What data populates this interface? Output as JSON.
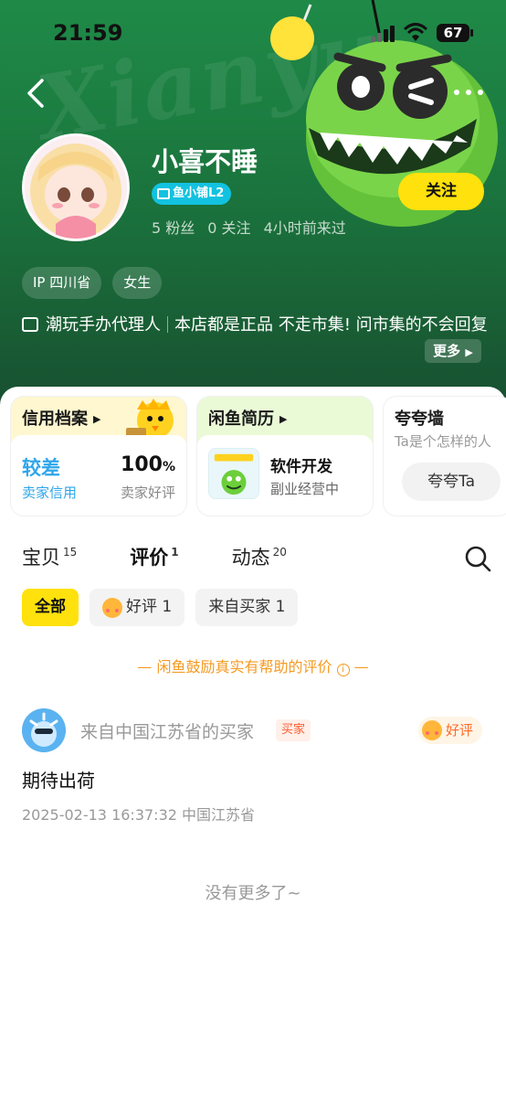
{
  "status_bar": {
    "time": "21:59",
    "battery": "67"
  },
  "header": {
    "watermark": "Xianyu",
    "username": "小喜不睡",
    "level_badge": "鱼小铺L2",
    "stats": {
      "fans": "5 粉丝",
      "following": "0 关注",
      "last_seen": "4小时前来过"
    },
    "follow_label": "关注",
    "tags": [
      "IP 四川省",
      "女生"
    ],
    "bio_part1": "潮玩手办代理人",
    "bio_part2": "本店都是正品  不走市集!  问市集的不会回复",
    "more_label": "更多"
  },
  "cards": {
    "credit": {
      "title": "信用档案",
      "level": "较差",
      "level_sub": "卖家信用",
      "rate": "100",
      "rate_unit": "%",
      "rate_sub": "卖家好评"
    },
    "resume": {
      "title": "闲鱼简历",
      "job": "软件开发",
      "job_sub": "副业经营中"
    },
    "praise": {
      "title": "夸夸墙",
      "subtitle": "Ta是个怎样的人",
      "button": "夸夸Ta"
    }
  },
  "tabs": [
    {
      "label": "宝贝",
      "count": "15"
    },
    {
      "label": "评价",
      "count": "1"
    },
    {
      "label": "动态",
      "count": "20"
    }
  ],
  "filters": {
    "all": "全部",
    "good": "好评 1",
    "from_buyer": "来自买家 1"
  },
  "notice": "— 闲鱼鼓励真实有帮助的评价",
  "notice_end": "—",
  "review": {
    "from": "来自中国江苏省的买家",
    "role_badge": "买家",
    "rating": "好评",
    "text": "期待出荷",
    "meta": "2025-02-13 16:37:32  中国江苏省"
  },
  "end_text": "没有更多了~",
  "colors": {
    "accent_yellow": "#ffe10d",
    "header_green": "#1c7d41",
    "credit_blue": "#2fa6ea",
    "notice_orange": "#f49a22"
  }
}
